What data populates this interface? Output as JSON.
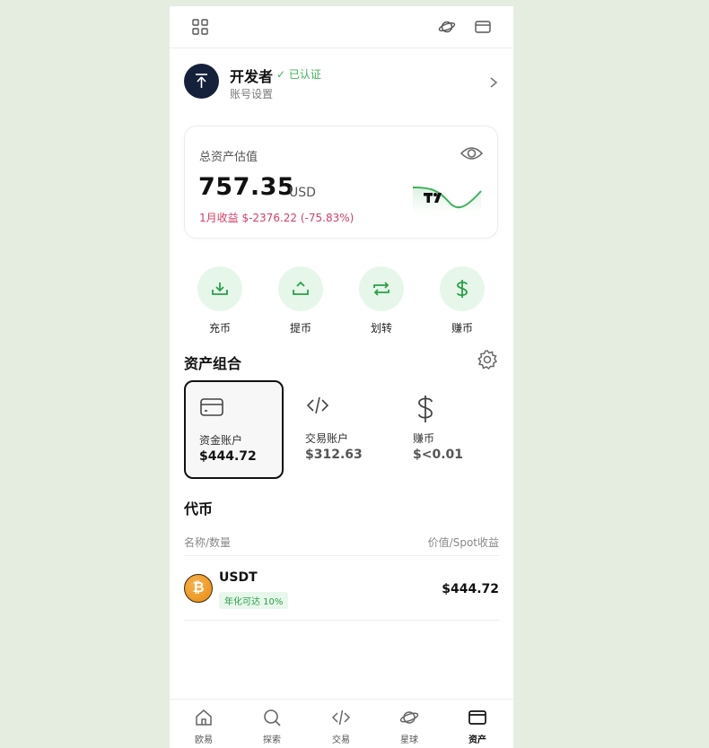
{
  "topbar": {
    "left_icon": "grid-icon",
    "right_icons": [
      "planet-icon",
      "wallet-icon"
    ]
  },
  "profile": {
    "name": "开发者",
    "verified": "✓ 已认证",
    "subtitle": "账号设置"
  },
  "summary": {
    "label": "总资产估值",
    "amount": "757.35",
    "currency": "USD",
    "pnl": "1月收益 $-2376.22 (-75.83%)",
    "pnl_color": "#d83d61"
  },
  "actions": [
    {
      "label": "充币",
      "icon": "deposit-icon"
    },
    {
      "label": "提币",
      "icon": "withdraw-icon"
    },
    {
      "label": "划转",
      "icon": "transfer-icon"
    },
    {
      "label": "赚币",
      "icon": "dollar-icon"
    }
  ],
  "portfolio": {
    "title": "资产组合",
    "accounts": [
      {
        "name": "资金账户",
        "value": "$444.72",
        "icon": "wallet-icon",
        "selected": true
      },
      {
        "name": "交易账户",
        "value": "$312.63",
        "icon": "code-icon",
        "selected": false
      },
      {
        "name": "赚币",
        "value": "$<0.01",
        "icon": "dollar-icon",
        "selected": false
      }
    ]
  },
  "tokens": {
    "title": "代币",
    "col_left": "名称/数量",
    "col_right": "价值/Spot收益",
    "rows": [
      {
        "symbol": "USDT",
        "tag": "年化可达 10%",
        "value": "$444.72",
        "coin_glyph": "₿"
      }
    ]
  },
  "nav": [
    {
      "label": "欧易",
      "icon": "home-icon",
      "active": false
    },
    {
      "label": "探索",
      "icon": "search-icon",
      "active": false
    },
    {
      "label": "交易",
      "icon": "code-icon",
      "active": false
    },
    {
      "label": "星球",
      "icon": "planet-icon",
      "active": false
    },
    {
      "label": "资产",
      "icon": "wallet-icon",
      "active": true
    }
  ],
  "colors": {
    "accent": "#3cb35a",
    "accent_bg": "#e6f7ea",
    "background": "#e5ece0"
  }
}
